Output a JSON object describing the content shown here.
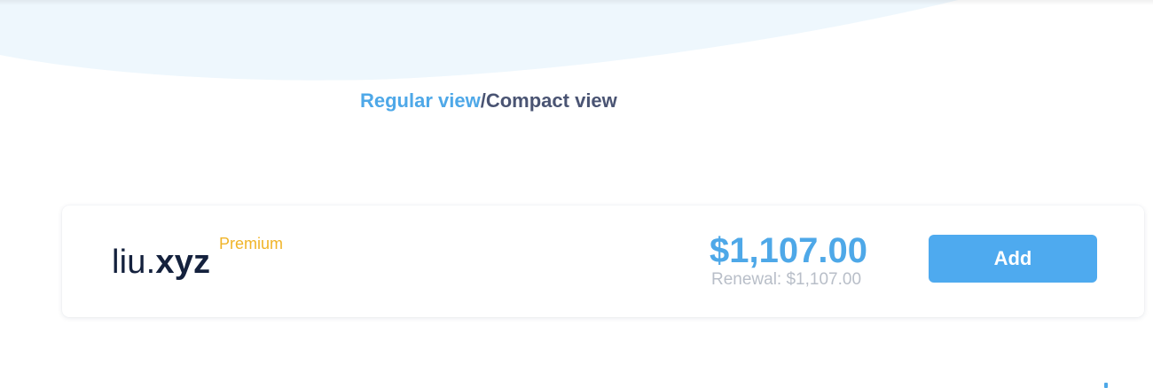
{
  "view_toggle": {
    "regular_label": "Regular view",
    "separator": "/",
    "compact_label": "Compact view"
  },
  "result": {
    "domain_sld": "liu.",
    "domain_tld": "xyz",
    "badge": "Premium",
    "price": "$1,107.00",
    "renewal": "Renewal: $1,107.00",
    "add_label": "Add"
  },
  "colors": {
    "accent": "#4ea8e8",
    "button": "#4eaaef",
    "premium": "#f0b429",
    "domain_text": "#14213d",
    "muted": "#b8bec8",
    "hero_wave": "#eef7fd"
  }
}
